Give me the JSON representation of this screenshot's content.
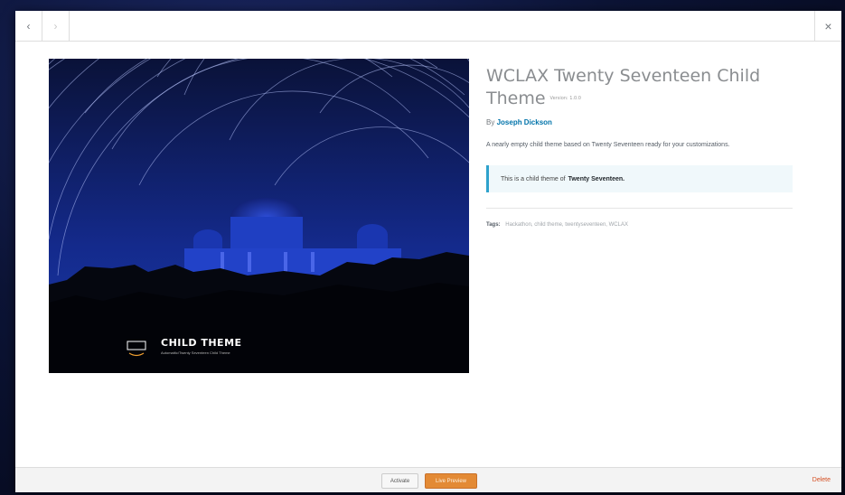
{
  "nav": {
    "prev_icon": "chevron-left-icon",
    "next_icon": "chevron-right-icon",
    "close_icon": "close-icon",
    "prev_glyph": "‹",
    "next_glyph": "›",
    "close_glyph": "×"
  },
  "screenshot": {
    "title": "CHILD THEME",
    "subtitle": "Automattic/Twenty Seventeen Child Theme"
  },
  "theme": {
    "name": "WCLAX Twenty Seventeen Child Theme",
    "version": "Version: 1.0.0",
    "author_prefix": "By",
    "author_name": "Joseph Dickson",
    "description": "A nearly empty child theme based on Twenty Seventeen ready for your customizations.",
    "parent_notice_prefix": "This is a child theme of",
    "parent_name": "Twenty Seventeen.",
    "tags_label": "Tags:",
    "tags": "Hackathon, child theme, twentyseventeen, WCLAX"
  },
  "footer": {
    "activate_label": "Activate",
    "live_preview_label": "Live Preview",
    "delete_label": "Delete"
  },
  "colors": {
    "accent": "#e38a35",
    "link": "#0073aa",
    "delete": "#d54e21",
    "notice_border": "#2ea2cc"
  }
}
